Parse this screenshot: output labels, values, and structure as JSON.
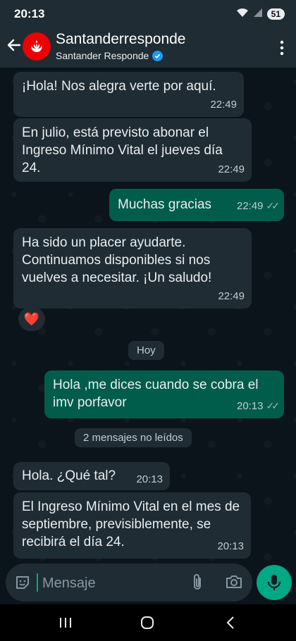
{
  "status_bar": {
    "time": "20:13",
    "battery": "51"
  },
  "header": {
    "title": "Santanderresponde",
    "subtitle": "Santander Responde"
  },
  "messages": [
    {
      "text": "¡Hola! Nos alegra verte por aquí.",
      "time": "22:49",
      "direction": "in"
    },
    {
      "text": "En julio, está previsto abonar el Ingreso Mínimo Vital el jueves día 24.",
      "time": "22:49",
      "direction": "in"
    },
    {
      "text": "Muchas gracias",
      "time": "22:49",
      "direction": "out",
      "read": true
    },
    {
      "text": "Ha sido un placer ayudarte. Continuamos disponibles si nos vuelves a necesitar. ¡Un saludo!",
      "time": "22:49",
      "direction": "in"
    },
    {
      "text": "Hola ,me dices cuando se cobra el imv porfavor",
      "time": "20:13",
      "direction": "out",
      "read": true
    },
    {
      "text": "Hola. ¿Qué tal?",
      "time": "20:13",
      "direction": "in"
    },
    {
      "text": "El Ingreso Mínimo Vital en el mes de septiembre, previsiblemente, se recibirá el día 24.",
      "time": "20:13",
      "direction": "in"
    }
  ],
  "reaction": "❤️",
  "date_separator": "Hoy",
  "unread_banner": "2 mensajes no leídos",
  "input": {
    "placeholder": "Mensaje"
  },
  "colors": {
    "incoming_bubble": "#1f2c34",
    "outgoing_bubble": "#005c4b",
    "accent": "#00a884",
    "brand": "#ec0000"
  }
}
